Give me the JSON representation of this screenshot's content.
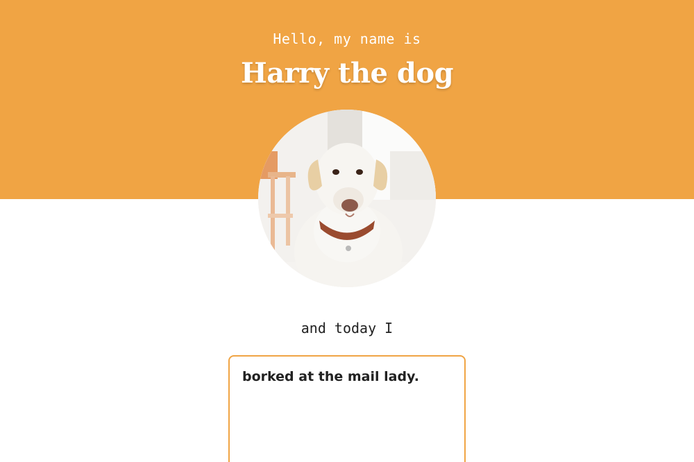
{
  "header": {
    "greeting": "Hello, my name is",
    "name": "Harry the dog"
  },
  "avatar": {
    "icon": "dog-photo",
    "alt": "Harry the dog"
  },
  "journal": {
    "prompt": "and today I",
    "entry_text": "borked at the mail lady."
  },
  "colors": {
    "accent": "#f0a444",
    "text": "#222222",
    "background": "#ffffff"
  }
}
